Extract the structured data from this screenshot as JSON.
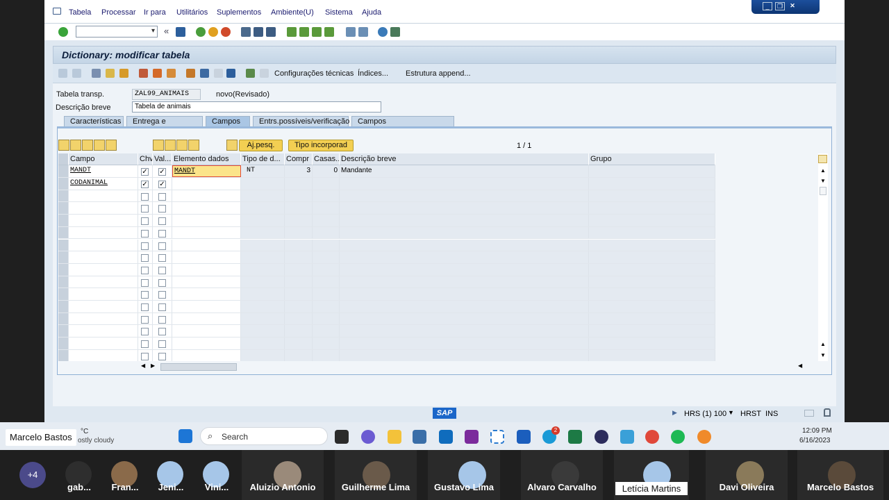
{
  "menu": {
    "items": [
      "Tabela",
      "Processar",
      "Ir para",
      "Utilitários",
      "Suplementos",
      "Ambiente(U)",
      "Sistema",
      "Ajuda"
    ]
  },
  "window": {
    "title": "Dictionary: modificar tabela"
  },
  "apptoolbar": {
    "config": "Configurações técnicas",
    "indices": "Índices...",
    "estrutura": "Estrutura append..."
  },
  "header": {
    "tabela_label": "Tabela transp.",
    "tabela_value": "ZAL99_ANIMAIS",
    "status": "novo(Revisado)",
    "descricao_label": "Descrição breve",
    "descricao_value": "Tabela de animais"
  },
  "tabs": [
    "Características",
    "Entrega e atualização",
    "Campos",
    "Entrs.possíveis/verificação",
    "Campos moeda/quantidade"
  ],
  "table_toolbar": {
    "ajpesq": "Aj.pesq.",
    "tipo": "Tipo incorporad",
    "pager": "1  /  1"
  },
  "grid": {
    "columns": [
      "Campo",
      "Chv",
      "Val...",
      "Elemento dados",
      "Tipo de d...",
      "Compr",
      "Casas...",
      "Descrição breve",
      "Grupo"
    ],
    "rows": [
      {
        "campo": "MANDT",
        "chv": "✓",
        "val": "✓",
        "elemento": "MANDT",
        "tipo": "NT",
        "compr": "3",
        "casas": "0",
        "descricao": "Mandante"
      },
      {
        "campo": "CODANIMAL",
        "chv": "✓",
        "val": "✓",
        "elemento": "",
        "tipo": "",
        "compr": "",
        "casas": "",
        "descricao": ""
      }
    ],
    "empty_rows": 14
  },
  "statusbar": {
    "sap": "SAP",
    "system": "HRS (1) 100",
    "server": "HRST",
    "mode": "INS"
  },
  "taskbar": {
    "weather_temp": "°C",
    "weather_desc": "ostly cloudy",
    "search": "Search",
    "time": "12:09 PM",
    "date": "6/16/2023",
    "skype_badge": "2"
  },
  "meeting": {
    "presenter_tag": "Marcelo Bastos",
    "more": "+4",
    "participants": [
      "gab...",
      "Fran...",
      "Jeni...",
      "Vini...",
      "Aluizio Antonio",
      "Guilherme Lima",
      "Gustavo Lima",
      "Alvaro Carvalho",
      "Letícia Martins",
      "Davi Oliveira",
      "Marcelo Bastos"
    ]
  },
  "colors": {
    "sap_bg": "#dfe8f1",
    "yellow_btn": "#f3cf52",
    "tab_active": "#aac6e4"
  }
}
